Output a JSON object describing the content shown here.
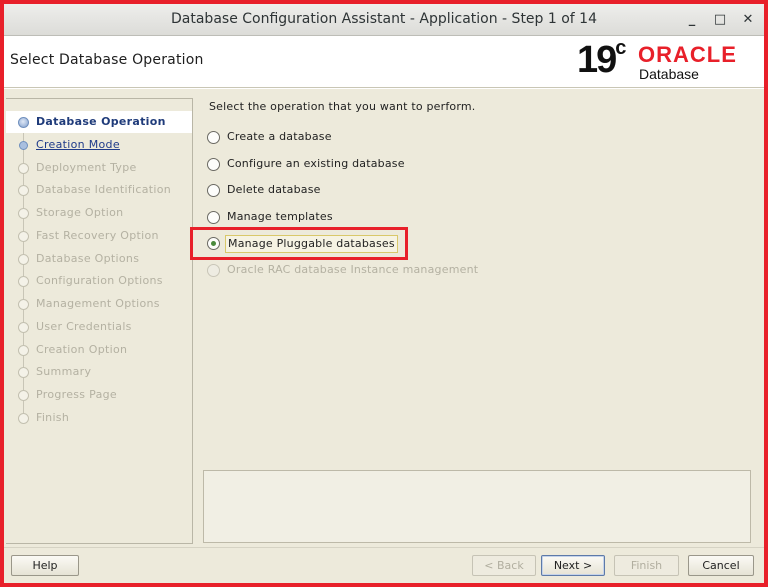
{
  "window": {
    "title": "Database Configuration Assistant - Application - Step 1 of 14",
    "minimize_glyph": "_",
    "maximize_glyph": "□",
    "close_glyph": "✕"
  },
  "header": {
    "page_title": "Select Database Operation",
    "logo": {
      "version": "19",
      "version_suffix": "c",
      "brand": "ORACLE",
      "product": "Database"
    }
  },
  "nav": {
    "items": [
      {
        "label": "Database Operation"
      },
      {
        "label": "Creation Mode"
      },
      {
        "label": "Deployment Type"
      },
      {
        "label": "Database Identification"
      },
      {
        "label": "Storage Option"
      },
      {
        "label": "Fast Recovery Option"
      },
      {
        "label": "Database Options"
      },
      {
        "label": "Configuration Options"
      },
      {
        "label": "Management Options"
      },
      {
        "label": "User Credentials"
      },
      {
        "label": "Creation Option"
      },
      {
        "label": "Summary"
      },
      {
        "label": "Progress Page"
      },
      {
        "label": "Finish"
      }
    ]
  },
  "main": {
    "prompt": "Select the operation that you want to perform.",
    "options": [
      {
        "label": "Create a database"
      },
      {
        "label": "Configure an existing database"
      },
      {
        "label": "Delete database"
      },
      {
        "label": "Manage templates"
      },
      {
        "label": "Manage Pluggable databases"
      },
      {
        "label": "Oracle RAC database Instance management"
      }
    ]
  },
  "footer": {
    "help": "Help",
    "back": "< Back",
    "next": "Next >",
    "finish": "Finish",
    "cancel": "Cancel"
  },
  "colors": {
    "annotation_red": "#e8202a",
    "oracle_red": "#e8202a",
    "panel_background": "#edeadb"
  }
}
